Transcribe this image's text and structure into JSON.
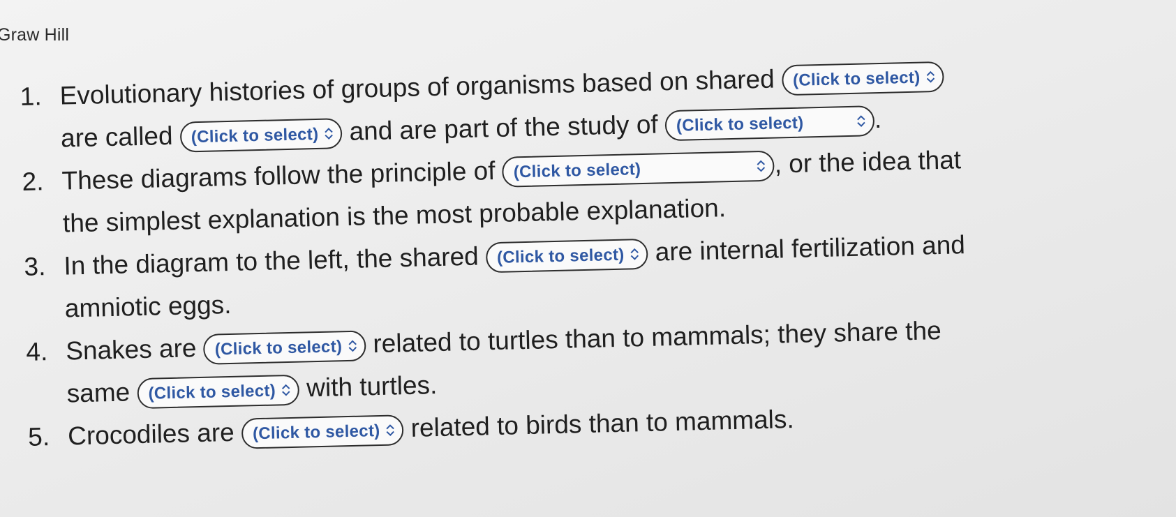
{
  "brand": "Graw Hill",
  "select_placeholder": "(Click to select)",
  "items": [
    {
      "num": "1.",
      "l1_a": "Evolutionary histories of groups of organisms based on shared",
      "l2_a": "are called",
      "l2_b": "and are part of the study of",
      "l2_c": "."
    },
    {
      "num": "2.",
      "l1_a": "These diagrams follow the principle of",
      "l1_b": ", or the idea that",
      "l2_a": "the simplest explanation is the most probable explanation."
    },
    {
      "num": "3.",
      "l1_a": "In the diagram to the left, the shared",
      "l1_b": "are internal fertilization and",
      "l2_a": "amniotic eggs."
    },
    {
      "num": "4.",
      "l1_a": "Snakes are",
      "l1_b": "related to turtles than to mammals; they share the",
      "l2_a": "same",
      "l2_b": "with turtles."
    },
    {
      "num": "5.",
      "l1_a": "Crocodiles are",
      "l1_b": "related to birds than to mammals."
    }
  ]
}
